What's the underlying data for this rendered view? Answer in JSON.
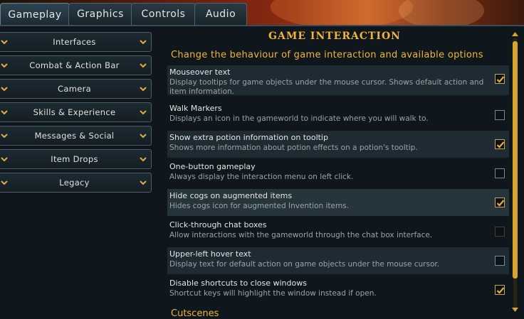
{
  "tabs": [
    {
      "label": "Gameplay",
      "active": true
    },
    {
      "label": "Graphics",
      "active": false
    },
    {
      "label": "Controls",
      "active": false
    },
    {
      "label": "Audio",
      "active": false
    }
  ],
  "sidebar": {
    "items": [
      {
        "label": "Interfaces"
      },
      {
        "label": "Combat & Action Bar"
      },
      {
        "label": "Camera"
      },
      {
        "label": "Skills & Experience"
      },
      {
        "label": "Messages & Social"
      },
      {
        "label": "Item Drops"
      },
      {
        "label": "Legacy"
      }
    ]
  },
  "main": {
    "title": "GAME INTERACTION",
    "subtitle": "Change the behaviour of game interaction and available options",
    "options": [
      {
        "title": "Mouseover text",
        "desc": "Display tooltips for game objects under the mouse cursor. Shows default action and item information.",
        "checked": true
      },
      {
        "title": "Walk Markers",
        "desc": "Displays an icon in the gameworld to indicate where you will walk to.",
        "checked": false
      },
      {
        "title": "Show extra potion information on tooltip",
        "desc": "Shows more information about potion effects on a potion's tooltip.",
        "checked": true
      },
      {
        "title": "One-button gameplay",
        "desc": "Always display the interaction menu on left click.",
        "checked": false
      },
      {
        "title": "Hide cogs on augmented items",
        "desc": "Hides cogs icon for augmented Invention items.",
        "checked": true
      },
      {
        "title": "Click-through chat boxes",
        "desc": "Allow interactions with the gameworld through the chat box interface.",
        "checked": false,
        "disabled": true
      },
      {
        "title": "Upper-left hover text",
        "desc": "Display text for default action on game objects under the mouse cursor.",
        "checked": false
      },
      {
        "title": "Disable shortcuts to close windows",
        "desc": "Shortcut keys will highlight the window instead if open.",
        "checked": true
      }
    ],
    "next_section": "Cutscenes"
  },
  "colors": {
    "accent": "#f0b43a",
    "check": "#e0b040",
    "panel": "#0f171c"
  },
  "icons": {
    "category_expand": "chevron-down-icon",
    "checkbox_checked": "checkmark-icon",
    "scroll_up": "arrow-up-icon",
    "scroll_down": "arrow-down-icon"
  }
}
